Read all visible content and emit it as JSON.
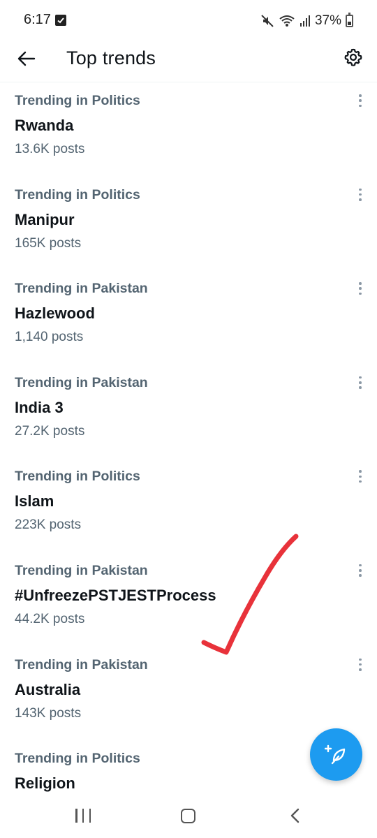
{
  "status_bar": {
    "time": "6:17",
    "battery": "37%",
    "battery_level": 0.37,
    "icons": [
      "check-notification-icon",
      "mute-icon",
      "wifi-icon",
      "signal-icon",
      "battery-icon"
    ]
  },
  "header": {
    "title": "Top trends",
    "back_icon": "arrow-left-icon",
    "settings_icon": "gear-icon"
  },
  "trends": [
    {
      "context": "Trending in Politics",
      "name": "Rwanda",
      "posts": "13.6K posts"
    },
    {
      "context": "Trending in Politics",
      "name": "Manipur",
      "posts": "165K posts"
    },
    {
      "context": "Trending in Pakistan",
      "name": "Hazlewood",
      "posts": "1,140 posts"
    },
    {
      "context": "Trending in Pakistan",
      "name": "India 3",
      "posts": "27.2K posts"
    },
    {
      "context": "Trending in Politics",
      "name": "Islam",
      "posts": "223K posts"
    },
    {
      "context": "Trending in Pakistan",
      "name": "#UnfreezePSTJESTProcess",
      "posts": "44.2K posts"
    },
    {
      "context": "Trending in Pakistan",
      "name": "Australia",
      "posts": "143K posts"
    },
    {
      "context": "Trending in Politics",
      "name": "Religion",
      "posts": ""
    }
  ],
  "fab": {
    "icon": "compose-feather-icon"
  },
  "annotation": {
    "color": "#e8323a",
    "icon": "red-checkmark-icon"
  },
  "colors": {
    "accent": "#1d9bf0",
    "primary_text": "#0f1419",
    "secondary_text": "#536471"
  }
}
